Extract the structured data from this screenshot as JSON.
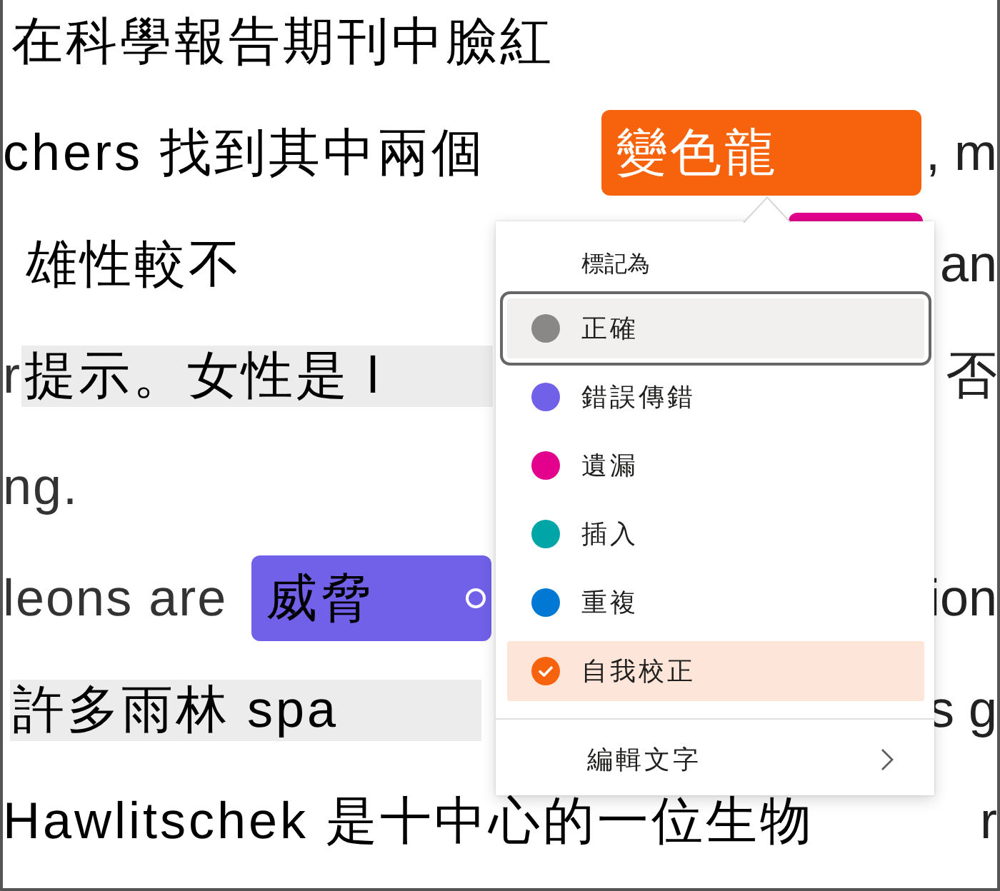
{
  "lines": [
    {
      "segments": [
        {
          "kind": "plain",
          "text": "在科學報告期刊中臉紅"
        }
      ]
    },
    {
      "segments": [
        {
          "kind": "plain",
          "text": "chers 找到其中兩個"
        },
        {
          "kind": "tag",
          "text": "變色龍",
          "color": "#f7630c",
          "active": true,
          "trailing_icon": false
        }
      ],
      "tail": ", m"
    },
    {
      "segments": [
        {
          "kind": "plain",
          "text": "雄性較不"
        },
        {
          "kind": "tag_edge",
          "color": "#e3008c"
        }
      ],
      "tail": "an"
    },
    {
      "segments": [
        {
          "kind": "muted",
          "text": "r"
        },
        {
          "kind": "highlight",
          "text": "提示。女性是 l"
        }
      ],
      "tail": "否"
    },
    {
      "segments": [
        {
          "kind": "muted",
          "text": "ng."
        }
      ]
    },
    {
      "segments": [
        {
          "kind": "muted",
          "text": "leons are"
        },
        {
          "kind": "tag",
          "text": "威脅",
          "color": "#7160e8",
          "active": false,
          "trailing_icon": true
        }
      ],
      "tail": "ion"
    },
    {
      "segments": [
        {
          "kind": "highlight",
          "text": "許多雨林 spa"
        }
      ],
      "tail": "s g"
    },
    {
      "segments": [
        {
          "kind": "plain",
          "text": "Hawlitschek 是十中心的一位生物"
        }
      ],
      "tail": "r"
    }
  ],
  "menu": {
    "header": "標記為",
    "items": [
      {
        "label": "正確",
        "color": "#8a8886",
        "focused": true,
        "selected": false
      },
      {
        "label": "錯誤傳錯",
        "color": "#7160e8",
        "focused": false,
        "selected": false
      },
      {
        "label": "遺漏",
        "color": "#e3008c",
        "focused": false,
        "selected": false
      },
      {
        "label": "插入",
        "color": "#00a5a8",
        "focused": false,
        "selected": false
      },
      {
        "label": "重複",
        "color": "#0078d4",
        "focused": false,
        "selected": false
      },
      {
        "label": "自我校正",
        "color": "#f7630c",
        "focused": false,
        "selected": true
      }
    ],
    "footer_item": {
      "label": "編輯文字",
      "submenu": true
    }
  }
}
